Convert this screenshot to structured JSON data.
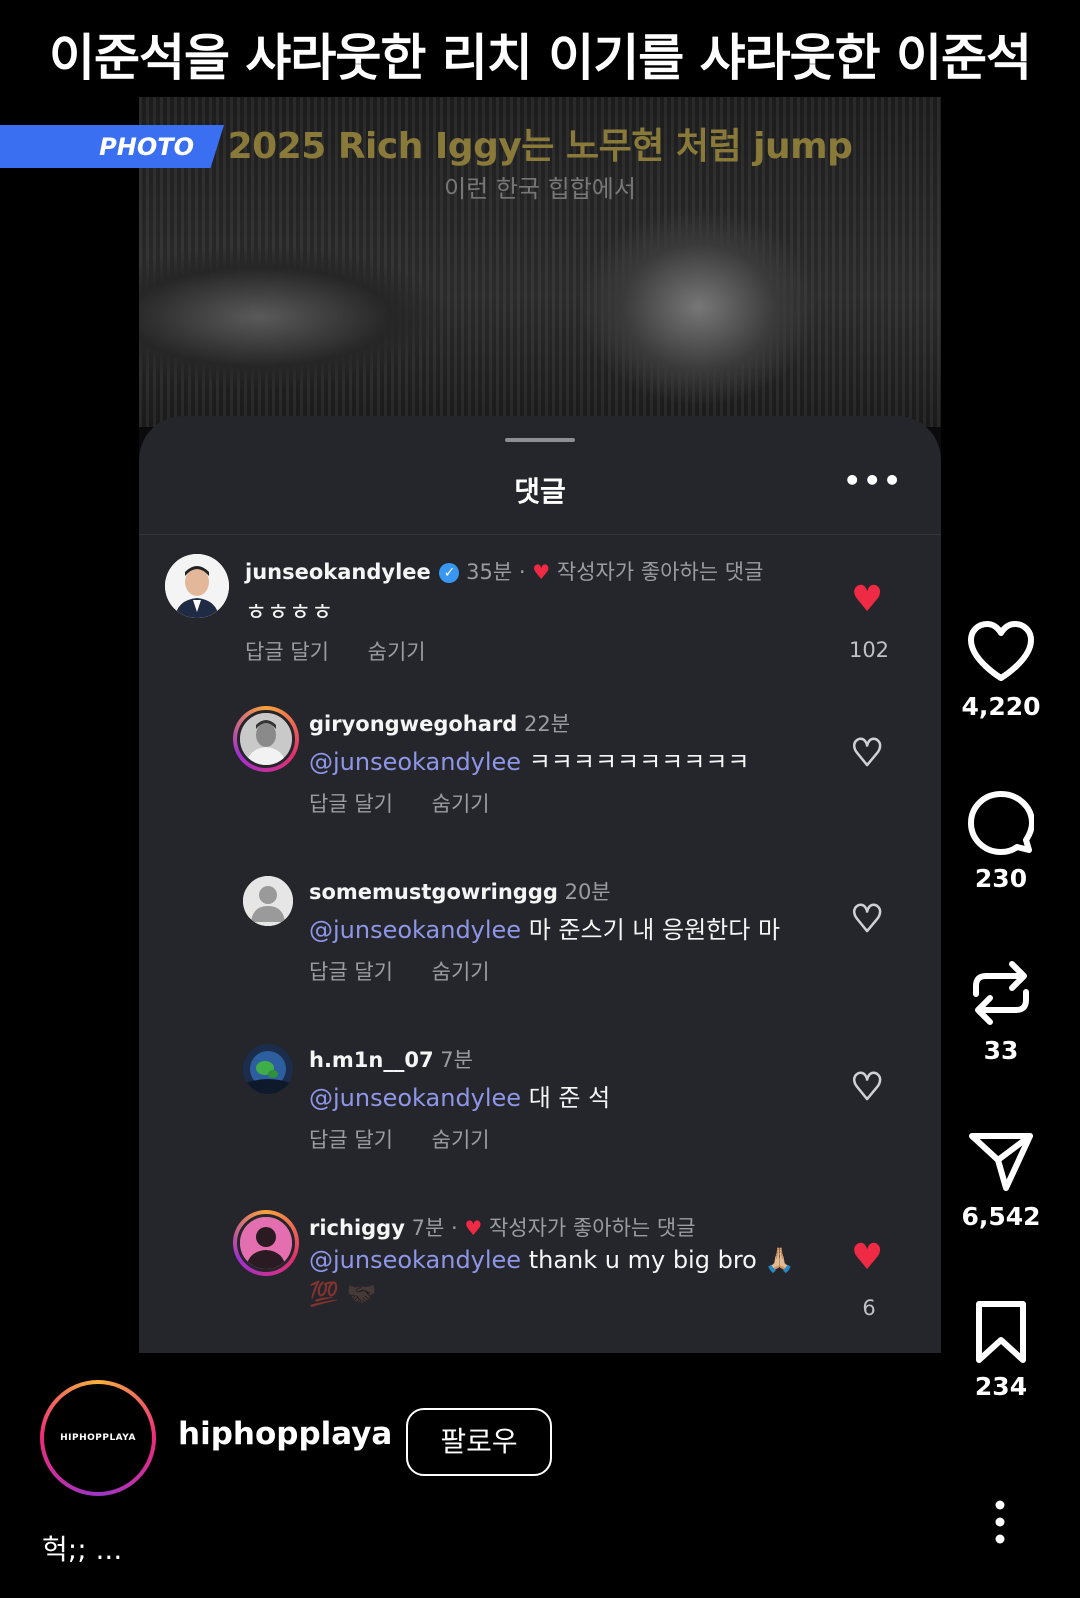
{
  "headline": "이준석을 샤라웃한 리치 이기를 샤라웃한 이준석",
  "badge": "PHOTO",
  "photo": {
    "title": "2025 Rich Iggy는 노무현 처럼 jump",
    "subtitle": "이런 한국 힙합에서"
  },
  "sheet": {
    "title": "댓글",
    "more": "•••"
  },
  "comments": [
    {
      "user": "junseokandylee",
      "verified": true,
      "time": "35분",
      "liked_label": "작성자가 좋아하는 댓글",
      "body_mention": "",
      "body": "ㅎㅎㅎㅎ",
      "reply": "답글 달기",
      "hide": "숨기기",
      "likes": "102",
      "liked": true
    },
    {
      "user": "giryongwegohard",
      "time": "22분",
      "body_mention": "@junseokandylee",
      "body": " ㅋㅋㅋㅋㅋㅋㅋㅋㅋㅋ",
      "reply": "답글 달기",
      "hide": "숨기기",
      "liked": false
    },
    {
      "user": "somemustgowringgg",
      "time": "20분",
      "body_mention": "@junseokandylee",
      "body": " 마 준스기 내 응원한다 마",
      "reply": "답글 달기",
      "hide": "숨기기",
      "liked": false
    },
    {
      "user": "h.m1n__07",
      "time": "7분",
      "body_mention": "@junseokandylee",
      "body": " 대 준 석",
      "reply": "답글 달기",
      "hide": "숨기기",
      "liked": false
    },
    {
      "user": "richiggy",
      "time": "7분",
      "liked_label": "작성자가 좋아하는 댓글",
      "body_mention": "@junseokandylee",
      "body": " thank u my big bro 🙏🏼",
      "body_line2": "💯 🤝🏿",
      "likes": "6",
      "liked": true
    }
  ],
  "rail": {
    "likes": "4,220",
    "comments": "230",
    "reposts": "33",
    "shares": "6,542",
    "saves": "234"
  },
  "profile": {
    "logo_text": "HIPHOPPLAYA",
    "name": "hiphopplaya",
    "follow": "팔로우"
  },
  "caption": "헉;; ...",
  "colors": {
    "accent_blue": "#3b6ff2",
    "heart_red": "#ee2a44",
    "mention": "#8f96e8",
    "sheet_bg": "#24262b"
  }
}
